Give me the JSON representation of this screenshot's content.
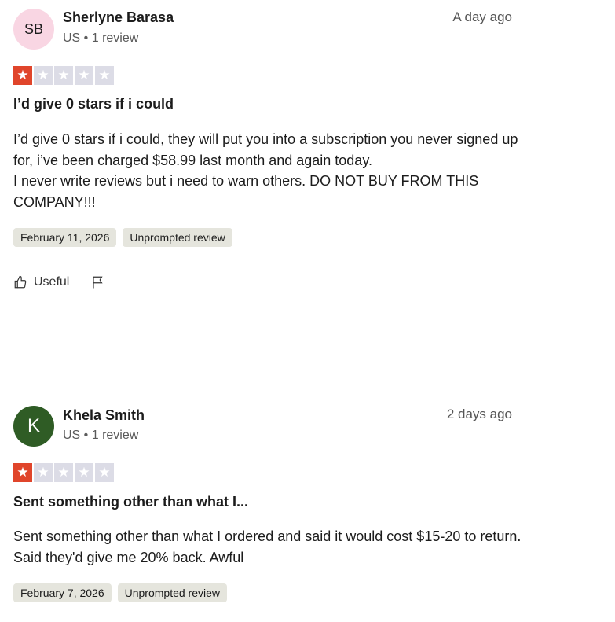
{
  "colors": {
    "star_filled": "#e0452b",
    "star_empty": "#dcdce6",
    "chip_bg": "#e5e5dd"
  },
  "reviews": [
    {
      "initials": "SB",
      "avatar_bg": "#f9d6e3",
      "avatar_fg": "#1c1c1c",
      "name": "Sherlyne Barasa",
      "meta": "US • 1 review",
      "time_ago": "A day ago",
      "rating": 1,
      "title": "I’d give 0 stars if i could",
      "body_lines": [
        "I’d give 0 stars if i could, they will put you into a subscription you never signed up for, i’ve been charged $58.99 last month and again today.",
        "I never write reviews but i need to warn others. DO NOT BUY FROM THIS COMPANY!!!"
      ],
      "date": "February 11, 2026",
      "tag": "Unprompted review",
      "useful_label": "Useful",
      "useful_icon": "thumbs-up-icon",
      "flag_icon": "flag-icon"
    },
    {
      "initials": "K",
      "avatar_bg": "#2f5c25",
      "avatar_fg": "#ffffff",
      "name": "Khela Smith",
      "meta": "US • 1 review",
      "time_ago": "2 days ago",
      "rating": 1,
      "title": "Sent something other than what I...",
      "body_lines": [
        "Sent something other than what I ordered and said it would cost $15-20 to return. Said they'd give me 20% back. Awful"
      ],
      "date": "February 7, 2026",
      "tag": "Unprompted review"
    }
  ]
}
